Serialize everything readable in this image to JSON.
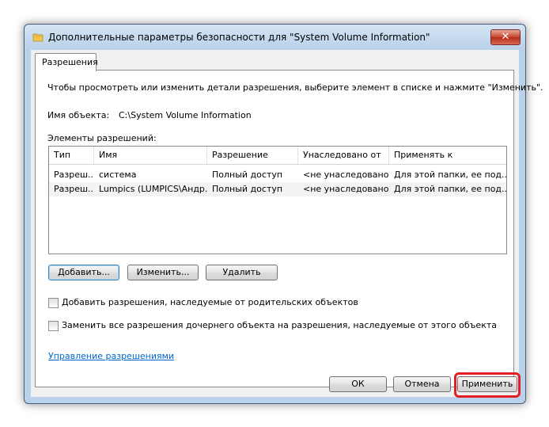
{
  "window": {
    "title": "Дополнительные параметры безопасности  для \"System Volume Information\"",
    "close_glyph": "✕"
  },
  "tab": {
    "label": "Разрешения"
  },
  "panel": {
    "description": "Чтобы просмотреть или изменить детали разрешения, выберите элемент в списке и нажмите \"Изменить\".",
    "object_name_label": "Имя объекта:",
    "object_name_value": "C:\\System Volume Information",
    "entries_label": "Элементы разрешений:"
  },
  "table": {
    "columns": [
      "Тип",
      "Имя",
      "Разрешение",
      "Унаследовано от",
      "Применять к"
    ],
    "rows": [
      [
        "Разреш...",
        "система",
        "Полный доступ",
        "<не унаследовано>",
        "Для этой папки, ее под..."
      ],
      [
        "Разреш...",
        "Lumpics (LUMPICS\\Андр...",
        "Полный доступ",
        "<не унаследовано>",
        "Для этой папки, ее под..."
      ]
    ]
  },
  "buttons": {
    "add": "Добавить...",
    "edit": "Изменить...",
    "delete": "Удалить",
    "ok": "ОК",
    "cancel": "Отмена",
    "apply": "Применить"
  },
  "checkboxes": {
    "inherit": {
      "label": "Добавить разрешения, наследуемые от родительских объектов",
      "checked": false
    },
    "replace": {
      "label": "Заменить все разрешения дочернего объекта на разрешения, наследуемые от этого объекта",
      "checked": false
    }
  },
  "links": {
    "manage": "Управление разрешениями"
  },
  "colors": {
    "highlight": "#e31e24",
    "link": "#0066cc",
    "title_bar": "#b9d1ea"
  }
}
